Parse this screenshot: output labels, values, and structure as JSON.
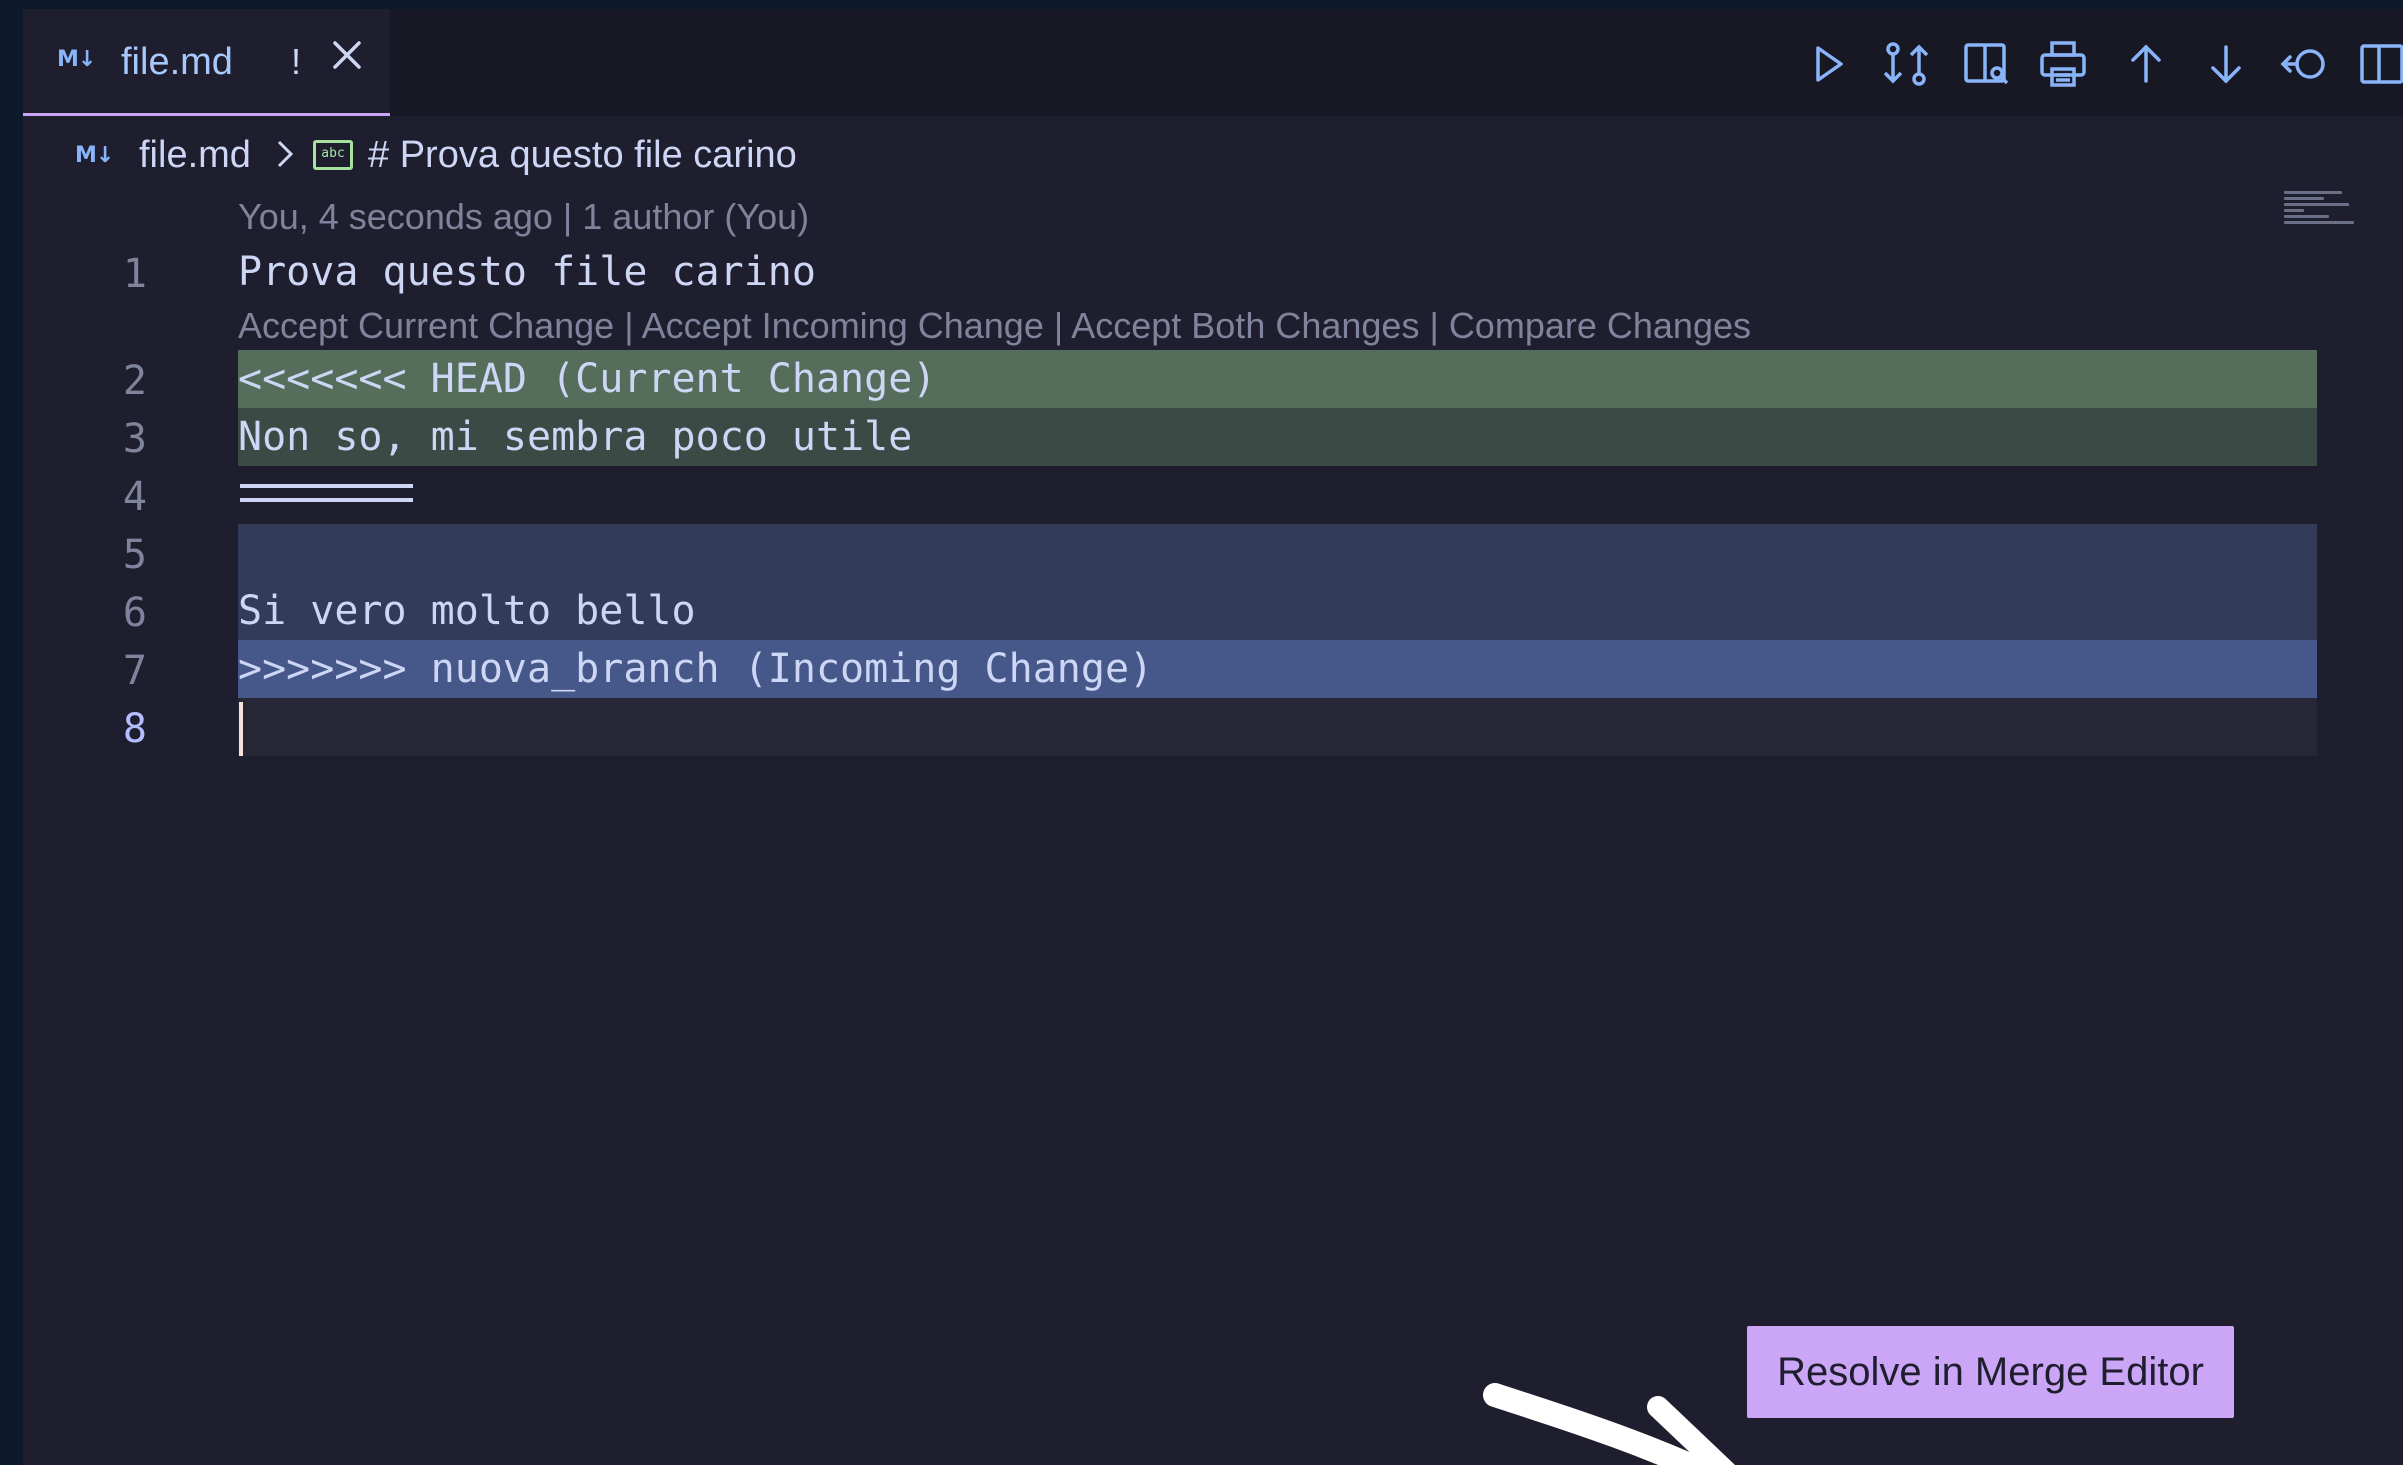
{
  "tab": {
    "icon_text": "M↓",
    "label": "file.md",
    "dirty_marker": "!"
  },
  "toolbar": {
    "icons": [
      "run-icon",
      "compare-changes-icon",
      "open-preview-icon",
      "print-icon",
      "arrow-up-icon",
      "arrow-down-icon",
      "go-back-icon",
      "split-editor-icon"
    ]
  },
  "breadcrumb": {
    "icon_text": "M↓",
    "file": "file.md",
    "symbol_icon_text": "abc",
    "heading": "# Prova questo file carino"
  },
  "editor": {
    "blame": "You, 4 seconds ago | 1 author (You)",
    "codelens": {
      "accept_current": "Accept Current Change",
      "accept_incoming": "Accept Incoming Change",
      "accept_both": "Accept Both Changes",
      "compare": "Compare Changes",
      "separator": " | "
    },
    "lines": [
      {
        "num": "1",
        "text": "Prova questo file carino"
      },
      {
        "num": "2",
        "text": "<<<<<<< HEAD (Current Change)"
      },
      {
        "num": "3",
        "text": "Non so, mi sembra poco utile"
      },
      {
        "num": "4",
        "text": ""
      },
      {
        "num": "5",
        "text": ""
      },
      {
        "num": "6",
        "text": "Si vero molto bello"
      },
      {
        "num": "7",
        "text": ">>>>>>> nuova_branch (Incoming Change)"
      },
      {
        "num": "8",
        "text": ""
      }
    ]
  },
  "resolve_button": {
    "label": "Resolve in Merge Editor"
  },
  "colors": {
    "accent": "#cba6f7",
    "current_change_header": "#556e5c",
    "current_change": "#3a4a44",
    "incoming_change": "#323b57",
    "incoming_change_header": "#46578a",
    "editor_bg": "#1e1e2e"
  }
}
